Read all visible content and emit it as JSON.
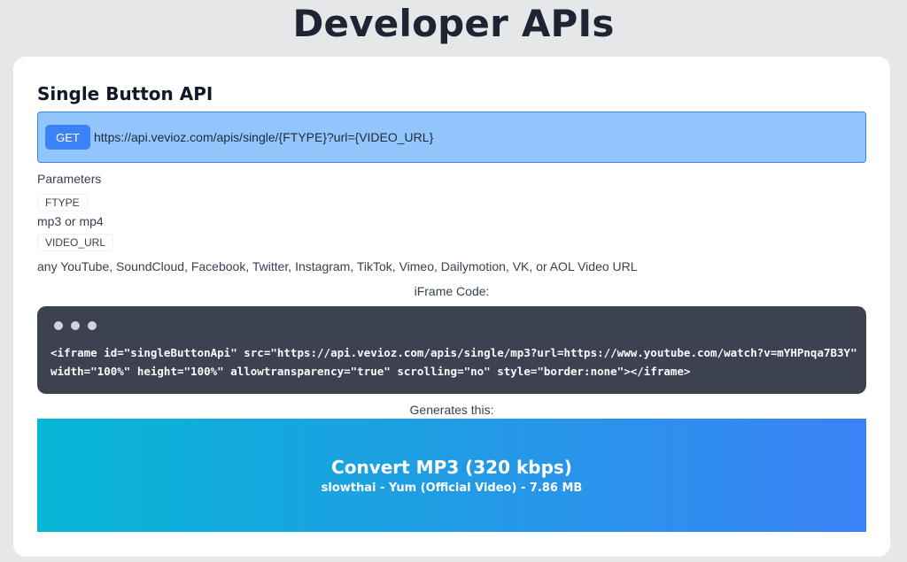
{
  "page": {
    "title": "Developer APIs"
  },
  "section": {
    "title": "Single Button API"
  },
  "endpoint": {
    "method": "GET",
    "url": "https://api.vevioz.com/apis/single/{FTYPE}?url={VIDEO_URL}"
  },
  "parameters": {
    "label": "Parameters",
    "items": [
      {
        "name": "FTYPE",
        "description": "mp3 or mp4"
      },
      {
        "name": "VIDEO_URL",
        "description": "any YouTube, SoundCloud, Facebook, Twitter, Instagram, TikTok, Vimeo, Dailymotion, VK, or AOL Video URL"
      }
    ]
  },
  "iframe": {
    "label": "iFrame Code:",
    "code_line1": "<iframe id=\"singleButtonApi\" src=\"https://api.vevioz.com/apis/single/mp3?url=https://www.youtube.com/watch?v=mYHPnqa7B3Y\"",
    "code_line2": "width=\"100%\" height=\"100%\" allowtransparency=\"true\" scrolling=\"no\" style=\"border:none\"></iframe>"
  },
  "generates": {
    "label": "Generates this:",
    "button_title": "Convert MP3 (320 kbps)",
    "button_subtitle": "slowthai - Yum (Official Video) - 7.86 MB"
  },
  "colors": {
    "endpoint_bg": "#93c5fd",
    "method_badge": "#3b82f6",
    "code_bg": "#3d4250",
    "gradient_start": "#06b6d4",
    "gradient_end": "#3b82f6"
  }
}
